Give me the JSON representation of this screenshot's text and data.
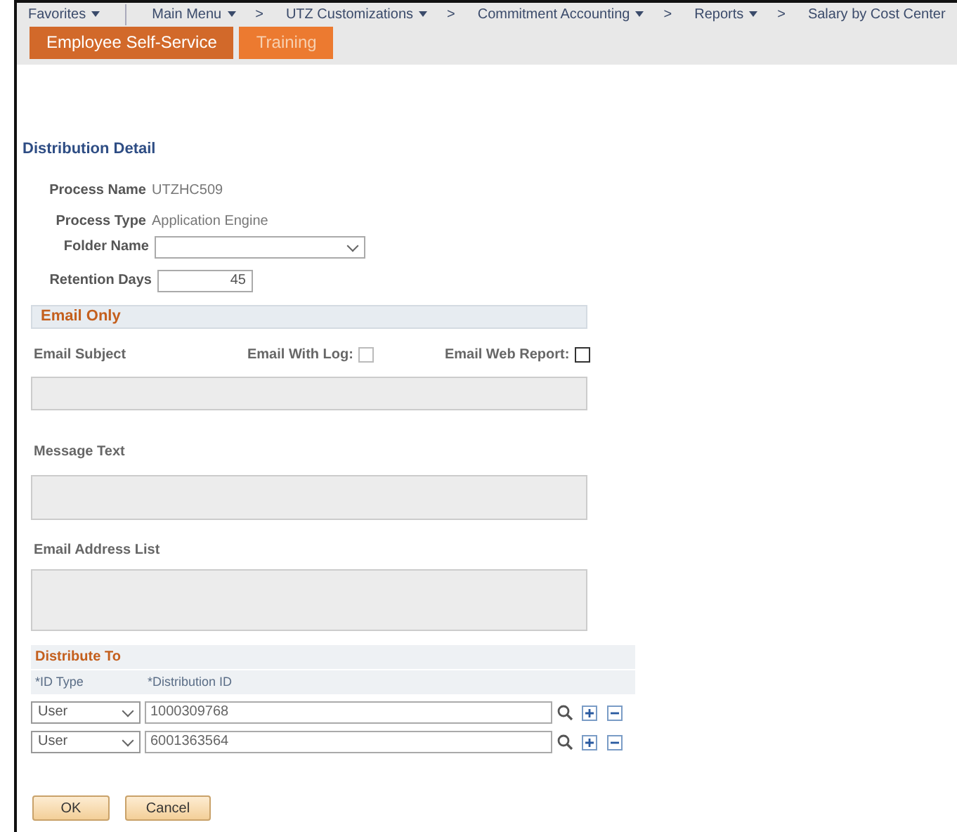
{
  "breadcrumbs": [
    {
      "label": "Favorites",
      "dropdown": true
    },
    {
      "label": "Main Menu",
      "dropdown": true
    },
    {
      "label": "UTZ Customizations",
      "separator": ">",
      "dropdown": true
    },
    {
      "label": "Commitment Accounting",
      "separator": ">",
      "dropdown": true
    },
    {
      "label": "Reports",
      "separator": ">",
      "dropdown": true
    },
    {
      "label": "Salary by Cost Center",
      "separator": ">",
      "dropdown": false
    }
  ],
  "tabs": [
    {
      "label": "Employee Self-Service",
      "selected": true
    },
    {
      "label": "Training",
      "selected": false
    }
  ],
  "page_title": "Distribution Detail",
  "process_name": {
    "label": "Process Name",
    "value": "UTZHC509"
  },
  "process_type": {
    "label": "Process Type",
    "value": "Application Engine"
  },
  "folder_name": {
    "label": "Folder Name"
  },
  "retention_days": {
    "label": "Retention Days",
    "value": "45"
  },
  "email_section": {
    "title": "Email Only",
    "email_subject": {
      "label": "Email Subject",
      "disabled": true
    },
    "email_with_log": {
      "label": "Email With Log:",
      "checked": false,
      "disabled": true
    },
    "email_web_report": {
      "label": "Email Web Report:",
      "checked": false,
      "disabled": false
    },
    "message_text": {
      "label": "Message Text",
      "disabled": true
    },
    "email_address_list": {
      "label": "Email Address List",
      "disabled": true
    }
  },
  "distribute_to": {
    "title": "Distribute To",
    "columns": [
      "*ID Type",
      "*Distribution ID"
    ],
    "rows": [
      {
        "id_type": "User",
        "distribution_id": "1000309768"
      },
      {
        "id_type": "User",
        "distribution_id": "6001363564"
      }
    ]
  },
  "buttons": [
    "OK",
    "Cancel"
  ]
}
